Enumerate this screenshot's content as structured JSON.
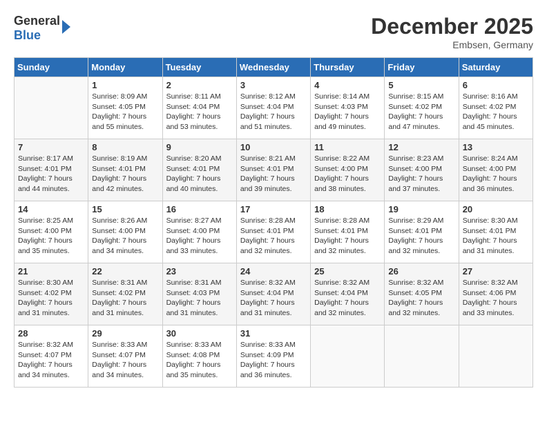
{
  "logo": {
    "text_general": "General",
    "text_blue": "Blue"
  },
  "title": "December 2025",
  "location": "Embsen, Germany",
  "days_header": [
    "Sunday",
    "Monday",
    "Tuesday",
    "Wednesday",
    "Thursday",
    "Friday",
    "Saturday"
  ],
  "weeks": [
    [
      {
        "day": "",
        "sunrise": "",
        "sunset": "",
        "daylight": ""
      },
      {
        "day": "1",
        "sunrise": "Sunrise: 8:09 AM",
        "sunset": "Sunset: 4:05 PM",
        "daylight": "Daylight: 7 hours and 55 minutes."
      },
      {
        "day": "2",
        "sunrise": "Sunrise: 8:11 AM",
        "sunset": "Sunset: 4:04 PM",
        "daylight": "Daylight: 7 hours and 53 minutes."
      },
      {
        "day": "3",
        "sunrise": "Sunrise: 8:12 AM",
        "sunset": "Sunset: 4:04 PM",
        "daylight": "Daylight: 7 hours and 51 minutes."
      },
      {
        "day": "4",
        "sunrise": "Sunrise: 8:14 AM",
        "sunset": "Sunset: 4:03 PM",
        "daylight": "Daylight: 7 hours and 49 minutes."
      },
      {
        "day": "5",
        "sunrise": "Sunrise: 8:15 AM",
        "sunset": "Sunset: 4:02 PM",
        "daylight": "Daylight: 7 hours and 47 minutes."
      },
      {
        "day": "6",
        "sunrise": "Sunrise: 8:16 AM",
        "sunset": "Sunset: 4:02 PM",
        "daylight": "Daylight: 7 hours and 45 minutes."
      }
    ],
    [
      {
        "day": "7",
        "sunrise": "Sunrise: 8:17 AM",
        "sunset": "Sunset: 4:01 PM",
        "daylight": "Daylight: 7 hours and 44 minutes."
      },
      {
        "day": "8",
        "sunrise": "Sunrise: 8:19 AM",
        "sunset": "Sunset: 4:01 PM",
        "daylight": "Daylight: 7 hours and 42 minutes."
      },
      {
        "day": "9",
        "sunrise": "Sunrise: 8:20 AM",
        "sunset": "Sunset: 4:01 PM",
        "daylight": "Daylight: 7 hours and 40 minutes."
      },
      {
        "day": "10",
        "sunrise": "Sunrise: 8:21 AM",
        "sunset": "Sunset: 4:01 PM",
        "daylight": "Daylight: 7 hours and 39 minutes."
      },
      {
        "day": "11",
        "sunrise": "Sunrise: 8:22 AM",
        "sunset": "Sunset: 4:00 PM",
        "daylight": "Daylight: 7 hours and 38 minutes."
      },
      {
        "day": "12",
        "sunrise": "Sunrise: 8:23 AM",
        "sunset": "Sunset: 4:00 PM",
        "daylight": "Daylight: 7 hours and 37 minutes."
      },
      {
        "day": "13",
        "sunrise": "Sunrise: 8:24 AM",
        "sunset": "Sunset: 4:00 PM",
        "daylight": "Daylight: 7 hours and 36 minutes."
      }
    ],
    [
      {
        "day": "14",
        "sunrise": "Sunrise: 8:25 AM",
        "sunset": "Sunset: 4:00 PM",
        "daylight": "Daylight: 7 hours and 35 minutes."
      },
      {
        "day": "15",
        "sunrise": "Sunrise: 8:26 AM",
        "sunset": "Sunset: 4:00 PM",
        "daylight": "Daylight: 7 hours and 34 minutes."
      },
      {
        "day": "16",
        "sunrise": "Sunrise: 8:27 AM",
        "sunset": "Sunset: 4:00 PM",
        "daylight": "Daylight: 7 hours and 33 minutes."
      },
      {
        "day": "17",
        "sunrise": "Sunrise: 8:28 AM",
        "sunset": "Sunset: 4:01 PM",
        "daylight": "Daylight: 7 hours and 32 minutes."
      },
      {
        "day": "18",
        "sunrise": "Sunrise: 8:28 AM",
        "sunset": "Sunset: 4:01 PM",
        "daylight": "Daylight: 7 hours and 32 minutes."
      },
      {
        "day": "19",
        "sunrise": "Sunrise: 8:29 AM",
        "sunset": "Sunset: 4:01 PM",
        "daylight": "Daylight: 7 hours and 32 minutes."
      },
      {
        "day": "20",
        "sunrise": "Sunrise: 8:30 AM",
        "sunset": "Sunset: 4:01 PM",
        "daylight": "Daylight: 7 hours and 31 minutes."
      }
    ],
    [
      {
        "day": "21",
        "sunrise": "Sunrise: 8:30 AM",
        "sunset": "Sunset: 4:02 PM",
        "daylight": "Daylight: 7 hours and 31 minutes."
      },
      {
        "day": "22",
        "sunrise": "Sunrise: 8:31 AM",
        "sunset": "Sunset: 4:02 PM",
        "daylight": "Daylight: 7 hours and 31 minutes."
      },
      {
        "day": "23",
        "sunrise": "Sunrise: 8:31 AM",
        "sunset": "Sunset: 4:03 PM",
        "daylight": "Daylight: 7 hours and 31 minutes."
      },
      {
        "day": "24",
        "sunrise": "Sunrise: 8:32 AM",
        "sunset": "Sunset: 4:04 PM",
        "daylight": "Daylight: 7 hours and 31 minutes."
      },
      {
        "day": "25",
        "sunrise": "Sunrise: 8:32 AM",
        "sunset": "Sunset: 4:04 PM",
        "daylight": "Daylight: 7 hours and 32 minutes."
      },
      {
        "day": "26",
        "sunrise": "Sunrise: 8:32 AM",
        "sunset": "Sunset: 4:05 PM",
        "daylight": "Daylight: 7 hours and 32 minutes."
      },
      {
        "day": "27",
        "sunrise": "Sunrise: 8:32 AM",
        "sunset": "Sunset: 4:06 PM",
        "daylight": "Daylight: 7 hours and 33 minutes."
      }
    ],
    [
      {
        "day": "28",
        "sunrise": "Sunrise: 8:32 AM",
        "sunset": "Sunset: 4:07 PM",
        "daylight": "Daylight: 7 hours and 34 minutes."
      },
      {
        "day": "29",
        "sunrise": "Sunrise: 8:33 AM",
        "sunset": "Sunset: 4:07 PM",
        "daylight": "Daylight: 7 hours and 34 minutes."
      },
      {
        "day": "30",
        "sunrise": "Sunrise: 8:33 AM",
        "sunset": "Sunset: 4:08 PM",
        "daylight": "Daylight: 7 hours and 35 minutes."
      },
      {
        "day": "31",
        "sunrise": "Sunrise: 8:33 AM",
        "sunset": "Sunset: 4:09 PM",
        "daylight": "Daylight: 7 hours and 36 minutes."
      },
      {
        "day": "",
        "sunrise": "",
        "sunset": "",
        "daylight": ""
      },
      {
        "day": "",
        "sunrise": "",
        "sunset": "",
        "daylight": ""
      },
      {
        "day": "",
        "sunrise": "",
        "sunset": "",
        "daylight": ""
      }
    ]
  ]
}
